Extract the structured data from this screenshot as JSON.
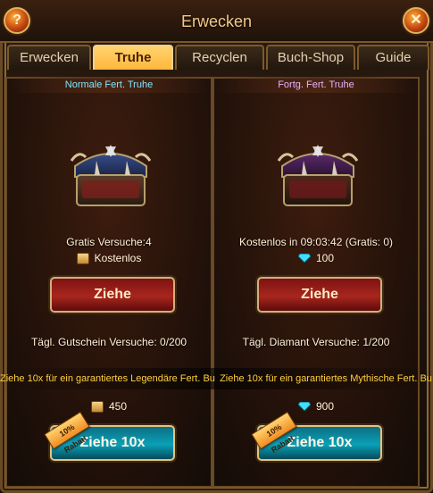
{
  "window": {
    "title": "Erwecken"
  },
  "tabs": [
    {
      "label": "Erwecken"
    },
    {
      "label": "Truhe",
      "active": true
    },
    {
      "label": "Recyclen"
    },
    {
      "label": "Buch-Shop"
    },
    {
      "label": "Guide"
    }
  ],
  "left_panel": {
    "header": "Normale Fert. Truhe",
    "free_attempts_text": "Gratis Versuche:4",
    "cost_icon": "scroll-icon",
    "cost_text": "Kostenlos",
    "pull_button": "Ziehe",
    "daily_text": "Tägl. Gutschein Versuche: 0/200",
    "banner_text": "Ziehe 10x für ein garantiertes Legendäre Fert. Bu",
    "bulk_cost_icon": "scroll-icon",
    "bulk_cost": "450",
    "bulk_button": "Ziehe 10x",
    "discount_badge": "10% Rabatt"
  },
  "right_panel": {
    "header": "Fortg. Fert. Truhe",
    "free_attempts_text": "Kostenlos in 09:03:42  (Gratis: 0)",
    "cost_icon": "diamond-icon",
    "cost_text": "100",
    "pull_button": "Ziehe",
    "daily_text": "Tägl. Diamant Versuche: 1/200",
    "banner_text": "Ziehe 10x für ein garantiertes Mythische Fert. Bu",
    "bulk_cost_icon": "diamond-icon",
    "bulk_cost": "900",
    "bulk_button": "Ziehe 10x",
    "discount_badge": "10% Rabatt"
  },
  "icons": {
    "help": "help-icon",
    "close": "close-icon"
  },
  "colors": {
    "left_header": "#7fe6ff",
    "right_header": "#e7b0ff",
    "banner_text": "#ffcf3f"
  }
}
